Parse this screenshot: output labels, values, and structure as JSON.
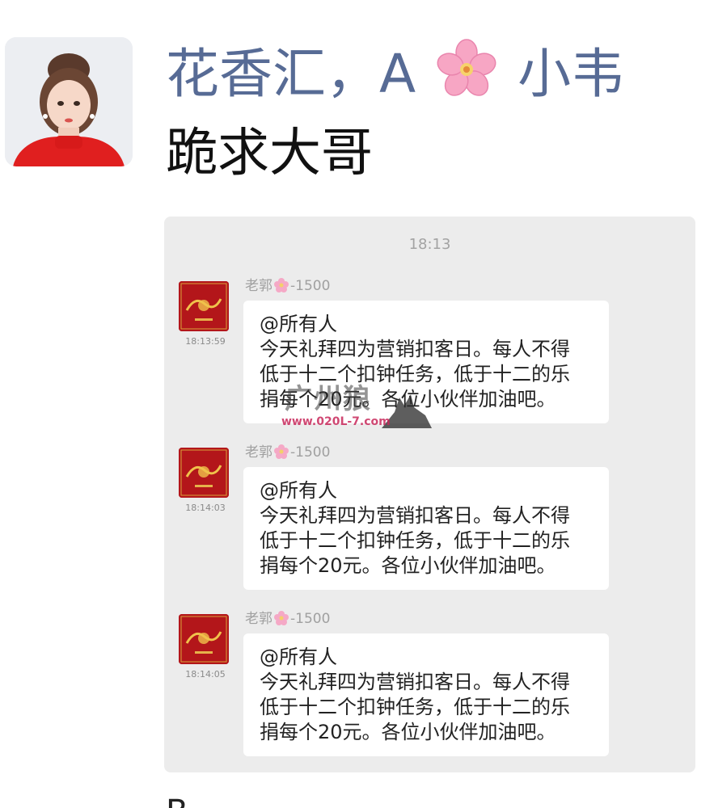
{
  "post": {
    "poster_name_left": "花香汇，A",
    "poster_name_right": "小韦",
    "poster_name_emoji": "cherry-blossom-icon",
    "text": "跪求大哥",
    "next_post_fragment": "B"
  },
  "card": {
    "time": "18:13",
    "messages": [
      {
        "sender_prefix": "老郭",
        "sender_suffix": "-1500",
        "timestamp": "18:13:59",
        "lines": [
          "@所有人",
          "今天礼拜四为营销扣客日。每人不得",
          "低于十二个扣钟任务，低于十二的乐",
          "捐每个20元。各位小伙伴加油吧。"
        ]
      },
      {
        "sender_prefix": "老郭",
        "sender_suffix": "-1500",
        "timestamp": "18:14:03",
        "lines": [
          "@所有人",
          "今天礼拜四为营销扣客日。每人不得",
          "低于十二个扣钟任务，低于十二的乐",
          "捐每个20元。各位小伙伴加油吧。"
        ]
      },
      {
        "sender_prefix": "老郭",
        "sender_suffix": "-1500",
        "timestamp": "18:14:05",
        "lines": [
          "@所有人",
          "今天礼拜四为营销扣客日。每人不得",
          "低于十二个扣钟任务，低于十二的乐",
          "捐每个20元。各位小伙伴加油吧。"
        ]
      }
    ]
  },
  "watermark": {
    "title": "广州狼",
    "url": "www.020L-7.com"
  },
  "colors": {
    "name_blue": "#576b95",
    "card_bg": "#ececec",
    "bubble_bg": "#ffffff",
    "muted_text": "#a0a0a0"
  }
}
